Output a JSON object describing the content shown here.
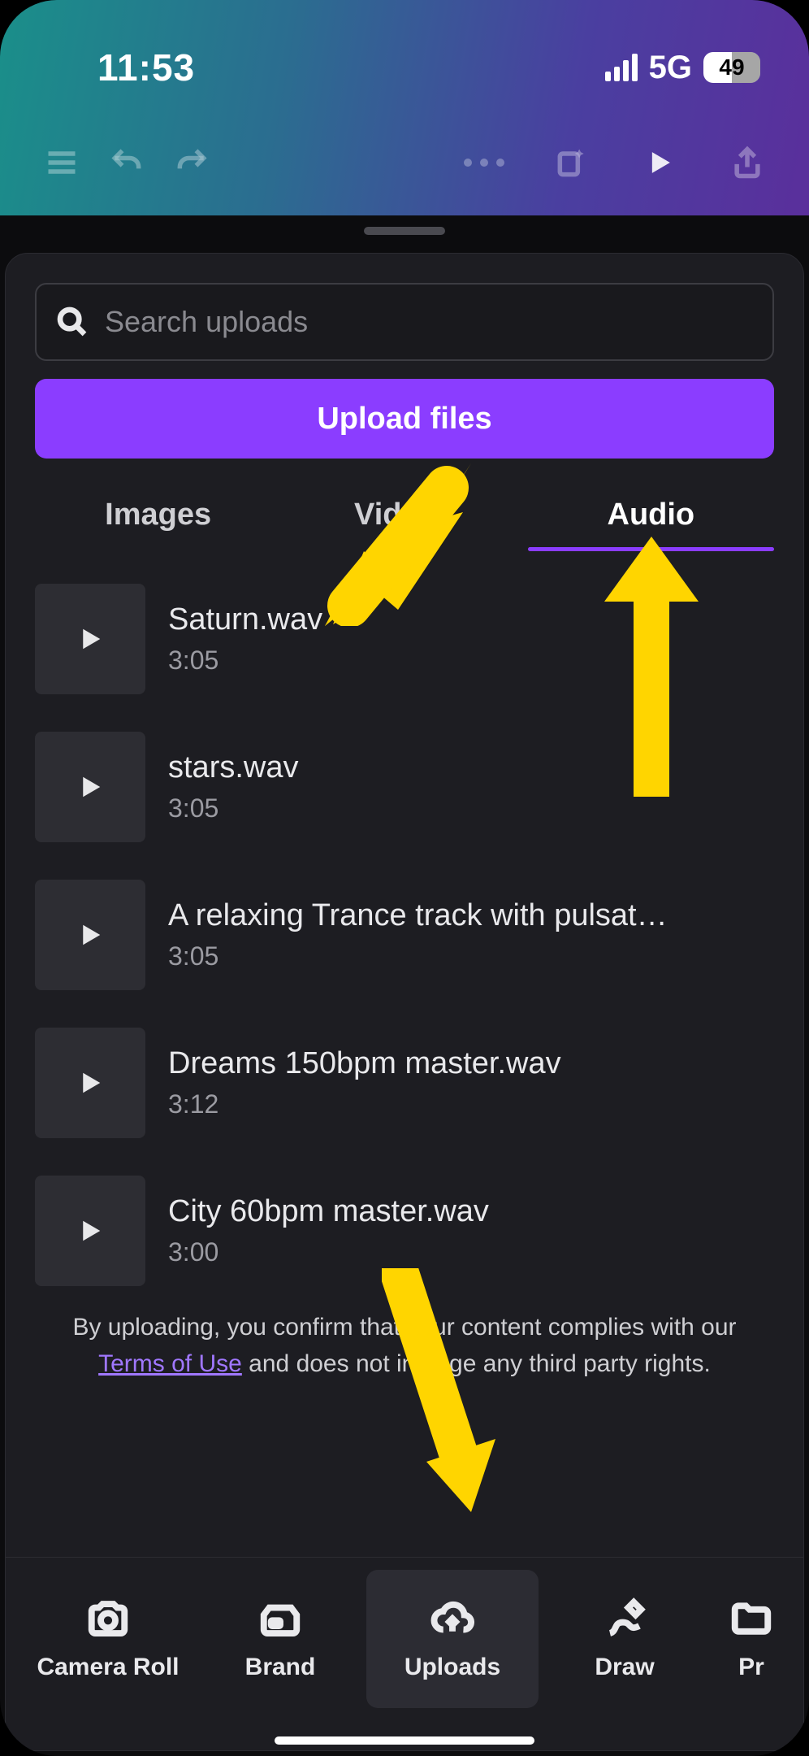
{
  "status": {
    "time": "11:53",
    "network": "5G",
    "battery": "49"
  },
  "search": {
    "placeholder": "Search uploads"
  },
  "upload_button": "Upload files",
  "tabs": {
    "images": "Images",
    "videos": "Videos",
    "audio": "Audio",
    "active": "audio"
  },
  "audio_items": [
    {
      "name": "Saturn.wav",
      "duration": "3:05"
    },
    {
      "name": "stars.wav",
      "duration": "3:05"
    },
    {
      "name": "A relaxing Trance track with pulsati…",
      "duration": "3:05"
    },
    {
      "name": "Dreams 150bpm master.wav",
      "duration": "3:12"
    },
    {
      "name": "City 60bpm master.wav",
      "duration": "3:00"
    }
  ],
  "disclaimer": {
    "pre": "By uploading, you confirm that your content complies with our ",
    "link": "Terms of Use",
    "post": " and does not infringe any third party rights."
  },
  "bottom_nav": {
    "camera_roll": "Camera Roll",
    "brand": "Brand",
    "uploads": "Uploads",
    "draw": "Draw",
    "projects": "Pr"
  }
}
